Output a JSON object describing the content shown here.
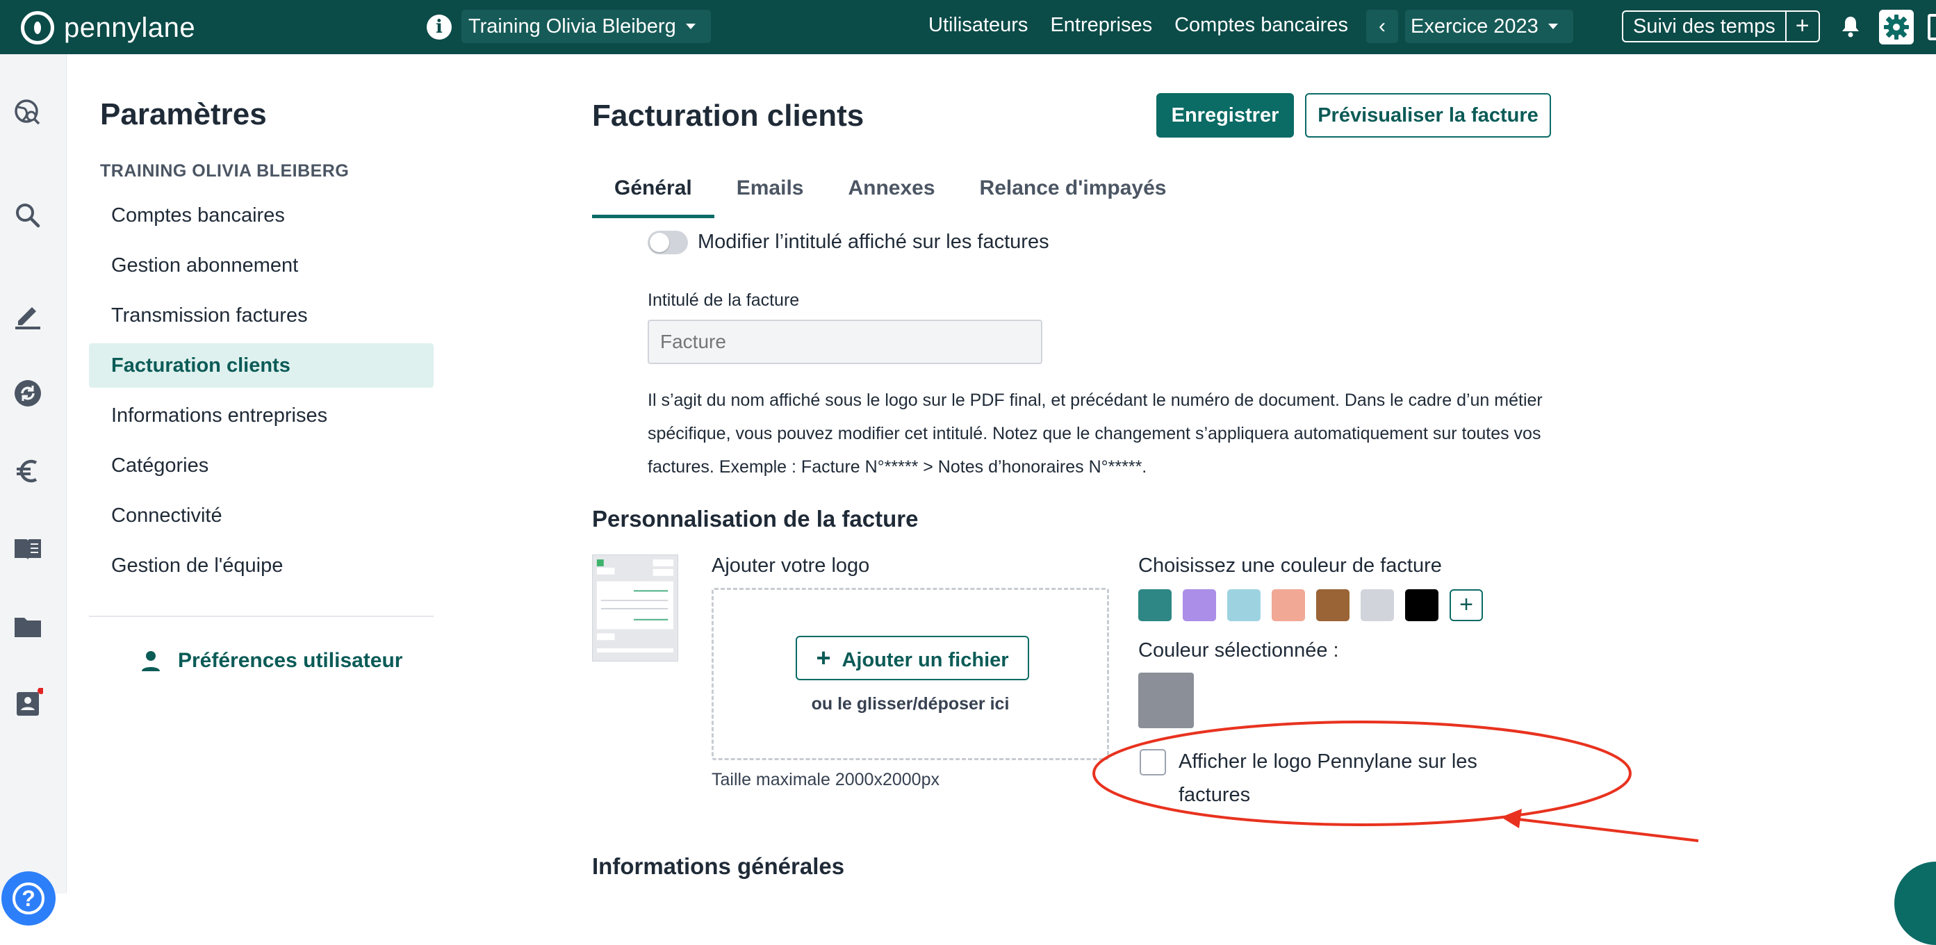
{
  "topbar": {
    "brand": "pennylane",
    "company": "Training Olivia Bleiberg",
    "nav": [
      "Utilisateurs",
      "Entreprises",
      "Comptes bancaires"
    ],
    "year": "Exercice 2023",
    "time_tracking": "Suivi des temps",
    "plus": "+"
  },
  "sidebar": {
    "title": "Paramètres",
    "org": "TRAINING OLIVIA BLEIBERG",
    "items": [
      {
        "label": "Comptes bancaires"
      },
      {
        "label": "Gestion abonnement"
      },
      {
        "label": "Transmission factures"
      },
      {
        "label": "Facturation clients"
      },
      {
        "label": "Informations entreprises"
      },
      {
        "label": "Catégories"
      },
      {
        "label": "Connectivité"
      },
      {
        "label": "Gestion de l'équipe"
      }
    ],
    "active_index": 3,
    "preferences": "Préférences utilisateur"
  },
  "main": {
    "title": "Facturation clients",
    "save_label": "Enregistrer",
    "preview_label": "Prévisualiser la facture",
    "tabs": [
      {
        "label": "Général"
      },
      {
        "label": "Emails"
      },
      {
        "label": "Annexes"
      },
      {
        "label": "Relance d'impayés"
      }
    ],
    "active_tab": 0,
    "toggle_label": "Modifier l’intitulé affiché sur les factures",
    "toggle_on": false,
    "invoice_title_label": "Intitulé de la facture",
    "invoice_title_placeholder": "Facture",
    "invoice_title_value": "",
    "help_text": "Il s’agit du nom affiché sous le logo sur le PDF final, et précédant le numéro de document. Dans le cadre d’un métier spécifique, vous pouvez modifier cet intitulé. Notez que le changement s’appliquera automatiquement sur toutes vos factures. Exemple : Facture N°***** > Notes d’honoraires N°*****.",
    "personalization_title": "Personnalisation de la facture",
    "logo_label": "Ajouter votre logo",
    "add_file_label": "Ajouter un fichier",
    "drop_hint": "ou le glisser/déposer ici",
    "max_size": "Taille maximale 2000x2000px",
    "color_label": "Choisissez une couleur de facture",
    "colors": [
      "#2e8784",
      "#ab8ee8",
      "#9dd3e1",
      "#f1a895",
      "#9a6436",
      "#d1d5db",
      "#000000"
    ],
    "selected_color_label": "Couleur sélectionnée :",
    "selected_color": "#8a8f98",
    "checkbox_label": "Afficher le logo Pennylane sur les factures",
    "checkbox_checked": false,
    "general_info_title": "Informations générales"
  },
  "colors": {
    "brand": "#0b4b48",
    "accent": "#0b6b65",
    "annotation": "#e8321f"
  }
}
